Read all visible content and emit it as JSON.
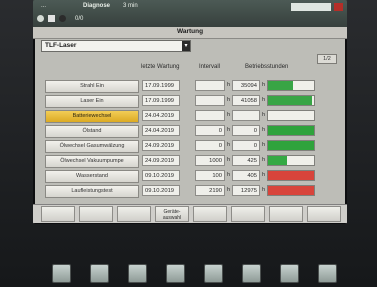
{
  "header": {
    "status_left": "...",
    "status_mid": "Diagnose",
    "status_right": "3 min",
    "status_small": "0/0"
  },
  "window": {
    "title": "Wartung"
  },
  "selector": {
    "value": "TLF-Laser"
  },
  "pager": {
    "label": "1/2"
  },
  "columns": {
    "last": "letzte Wartung",
    "interval": "Intervall",
    "hours": "Betriebsstunden"
  },
  "units": {
    "h": "h"
  },
  "rows": [
    {
      "name": "Strahl Ein",
      "date": "17.09.1999",
      "interval": "",
      "hours": "35094",
      "level": 0.55,
      "color": "#38a545",
      "highlight": false
    },
    {
      "name": "Laser Ein",
      "date": "17.09.1999",
      "interval": "",
      "hours": "41058",
      "level": 0.95,
      "color": "#38a545",
      "highlight": false
    },
    {
      "name": "Batteriewechsel",
      "date": "24.04.2019",
      "interval": "",
      "hours": "",
      "level": 0.0,
      "color": "#38a545",
      "highlight": true
    },
    {
      "name": "Ölstand",
      "date": "24.04.2019",
      "interval": "0",
      "hours": "0",
      "level": 1.0,
      "color": "#2fa33c",
      "highlight": false
    },
    {
      "name": "Ölwechsel Gasumwälzung",
      "date": "24.09.2019",
      "interval": "0",
      "hours": "0",
      "level": 1.0,
      "color": "#2fa33c",
      "highlight": false
    },
    {
      "name": "Ölwechsel Vakuumpumpe",
      "date": "24.09.2019",
      "interval": "1000",
      "hours": "425",
      "level": 0.42,
      "color": "#34a943",
      "highlight": false
    },
    {
      "name": "Wasserstand",
      "date": "09.10.2019",
      "interval": "100",
      "hours": "405",
      "level": 1.0,
      "color": "#d8443b",
      "highlight": false
    },
    {
      "name": "Laufleistungstest",
      "date": "09.10.2019",
      "interval": "2190",
      "hours": "12975",
      "level": 1.0,
      "color": "#d8443b",
      "highlight": false
    }
  ],
  "softkeys": [
    "",
    "",
    "",
    "Geräte-\nauswahl",
    "",
    "",
    "",
    ""
  ]
}
